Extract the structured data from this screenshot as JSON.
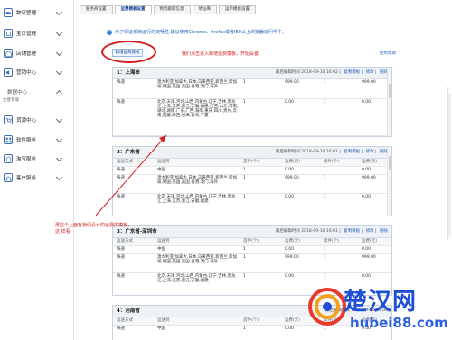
{
  "sidebar": {
    "items": [
      {
        "label": "物流管理",
        "icon": "truck-icon"
      },
      {
        "label": "宝贝管理",
        "icon": "box-icon"
      },
      {
        "label": "店铺管理",
        "icon": "store-icon"
      },
      {
        "label": "营销中心",
        "icon": "megaphone-icon"
      }
    ],
    "data_center": {
      "label": "数据中心",
      "sub": "生意参谋"
    },
    "items2": [
      {
        "label": "货源中心",
        "icon": "cart-icon"
      },
      {
        "label": "软件服务",
        "icon": "software-icon"
      },
      {
        "label": "淘宝服务",
        "icon": "service-icon"
      },
      {
        "label": "客户服务",
        "icon": "headset-icon"
      }
    ]
  },
  "tabs": [
    "服务商设置",
    "运费模板设置",
    "物流跟踪信息",
    "地址库",
    "运单模板设置"
  ],
  "notice": "为了保证系统运行的流畅性,建议使用Chrome、firefox或者IE9以上浏览器访问千牛。",
  "add_button": "新增运费模板",
  "hint": "我们点击进入新增运费模板，开始设置",
  "help_link": "使用帮助",
  "annotation": "那这个上面有我们设计的运费的模板，这 样看",
  "table_headers": [
    "运送方式",
    "运送到",
    "首件(个)",
    "运费(元)",
    "续件(个)",
    "运费(元)"
  ],
  "meta": {
    "edit_prefix": "最后编辑时间",
    "copy": "复制模板",
    "modify": "修改",
    "delete": "删除"
  },
  "blocks": [
    {
      "title": "1：上海市",
      "time": "2018-09-10 16:02",
      "rows": [
        {
          "method": "快递",
          "dest": "澳大利亚,加拿大,日本,马来西亚,新西兰,新加坡,韩国,英国,美国,香港,澳门,海外",
          "first": "1",
          "first_fee": "999.00",
          "next": "1",
          "next_fee": "999.00"
        },
        {
          "method": "快递",
          "dest": "北京,天津,河北,山西,内蒙古,辽宁,吉林,黑龙江,上海,江苏,浙江,安徽,福建,江西,山东,河南,湖北,湖南,广东,广西,海南,重庆,四川,贵州,云南,西藏,陕西,甘肃,青海,宁夏",
          "first": "1",
          "first_fee": "0.00",
          "next": "1",
          "next_fee": "0.00"
        }
      ]
    },
    {
      "title": "2：广东省",
      "time": "2018-09-10 16:01",
      "rows": [
        {
          "method": "快递",
          "dest": "中国",
          "first": "1",
          "first_fee": "0.00",
          "next": "1",
          "next_fee": "0.00"
        },
        {
          "method": "快递",
          "dest": "澳大利亚,加拿大,日本,马来西亚,新西兰,新加坡,韩国,英国,美国,香港,澳门,海外",
          "first": "1",
          "first_fee": "999.00",
          "next": "1",
          "next_fee": "999.00"
        },
        {
          "method": "快递",
          "dest": "北京,天津,河北,山西,内蒙古,辽宁,吉林,黑龙江,上海,江苏,浙江,安徽,福建",
          "first": "1",
          "first_fee": "0.00",
          "next": "1",
          "next_fee": "0.00"
        }
      ]
    },
    {
      "title": "3：广东省-深圳市",
      "time": "2018-09-10 16:01",
      "rows": [
        {
          "method": "快递",
          "dest": "中国",
          "first": "1",
          "first_fee": "0.00",
          "next": "1",
          "next_fee": "0.00"
        },
        {
          "method": "快递",
          "dest": "澳大利亚,加拿大,日本,马来西亚,新西兰,新加坡,韩国,英国,美国,香港,澳门,海外",
          "first": "1",
          "first_fee": "999.00",
          "next": "1",
          "next_fee": "999.00"
        },
        {
          "method": "快递",
          "dest": "北京,天津,河北,山西,内蒙古,辽宁,吉林,黑龙江,上海,江苏,浙江,安徽,福建",
          "first": "1",
          "first_fee": "0.00",
          "next": "1",
          "next_fee": "0.00"
        }
      ]
    },
    {
      "title": "4：河南省",
      "time": "2018-09-10 16:00",
      "rows": [
        {
          "method": "快递",
          "dest": "中国",
          "first": "1",
          "first_fee": "0.00",
          "next": "1",
          "next_fee": "0.00"
        }
      ]
    }
  ],
  "watermark": {
    "main": "楚汉网",
    "sub": "hubei88.com"
  },
  "colors": {
    "accent": "#2a62b9",
    "annotation": "#d12020",
    "watermark": "#1f4fd6"
  }
}
